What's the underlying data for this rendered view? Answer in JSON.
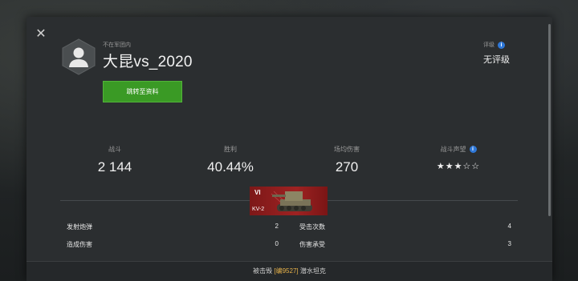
{
  "header": {
    "close_icon": "close-icon",
    "clan_status": "不在军团内",
    "player_name": "大昆vs_2020",
    "profile_button": "跳转至资料",
    "rating_label": "评级",
    "rating_value": "无评级",
    "info_icon": "i"
  },
  "stats": [
    {
      "label": "战斗",
      "value": "2 144"
    },
    {
      "label": "胜利",
      "value": "40.44%"
    },
    {
      "label": "场均伤害",
      "value": "270"
    },
    {
      "label": "战斗声望",
      "value": "★★★☆☆",
      "stars": 3,
      "max_stars": 5
    }
  ],
  "tank": {
    "tier": "VI",
    "name": "KV-2",
    "color": "#9e2222"
  },
  "details": {
    "left": [
      {
        "label": "发射炮弹",
        "value": "2"
      },
      {
        "label": "造成伤害",
        "value": "0"
      }
    ],
    "right": [
      {
        "label": "受击次数",
        "value": "4"
      },
      {
        "label": "伤害承受",
        "value": "3"
      }
    ]
  },
  "footer": {
    "prefix": "被击毁",
    "tag": "[编9527]",
    "suffix": "潜水坦克"
  },
  "colors": {
    "accent_green": "#3a9a25",
    "info_blue": "#2f78d8",
    "highlight": "#e8b34a"
  }
}
